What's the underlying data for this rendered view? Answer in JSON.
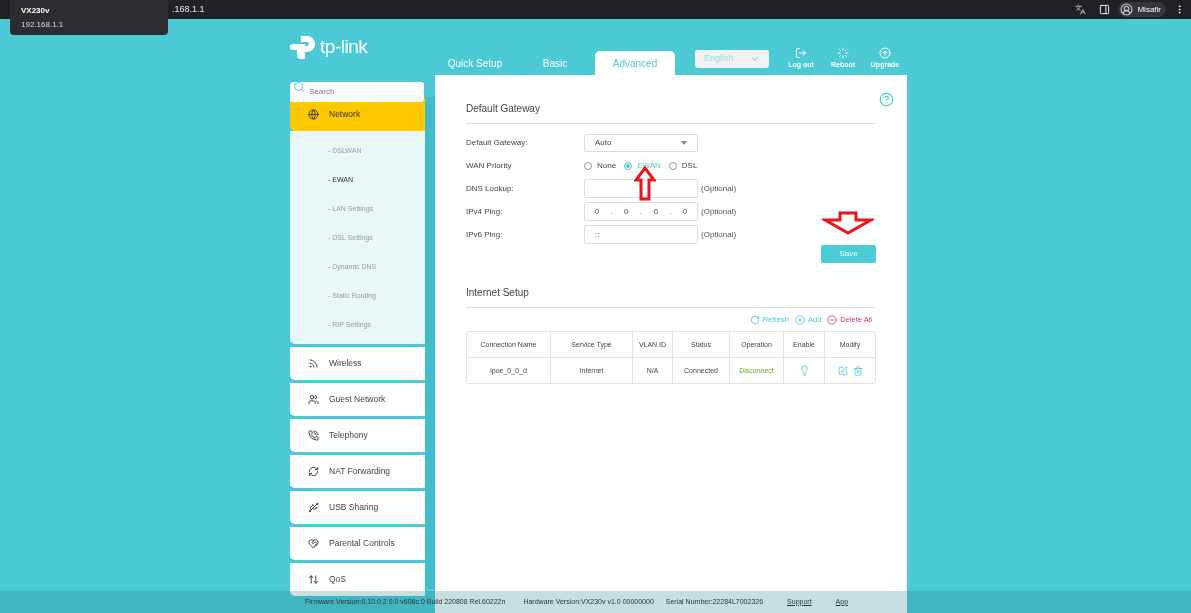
{
  "browser": {
    "address": ".168.1.1",
    "tooltip_title": "VX230v",
    "tooltip_url": "192.168.1.1",
    "profile": "Misafir"
  },
  "header": {
    "logo": "tp-link",
    "tabs": [
      {
        "label": "Quick Setup",
        "selected": false
      },
      {
        "label": "Basic",
        "selected": false
      },
      {
        "label": "Advanced",
        "selected": true
      }
    ],
    "language": "English",
    "actions": [
      {
        "kind": "logout",
        "label": "Log out"
      },
      {
        "kind": "reboot",
        "label": "Reboot"
      },
      {
        "kind": "upgrade",
        "label": "Upgrade"
      }
    ]
  },
  "search": {
    "placeholder": "Search"
  },
  "sidebar": {
    "items": [
      {
        "kind": "globe",
        "label": "Network",
        "selected": true,
        "expanded": true,
        "children": [
          {
            "label": "- DSLWAN",
            "selected": false
          },
          {
            "label": "- EWAN",
            "selected": true
          },
          {
            "label": "- LAN Settings",
            "selected": false
          },
          {
            "label": "- DSL Settings",
            "selected": false
          },
          {
            "label": "- Dynamic DNS",
            "selected": false
          },
          {
            "label": "- Static Routing",
            "selected": false
          },
          {
            "label": "- RIP Settings",
            "selected": false
          }
        ]
      },
      {
        "kind": "wireless",
        "label": "Wireless",
        "selected": false
      },
      {
        "kind": "guests",
        "label": "Guest Network",
        "selected": false
      },
      {
        "kind": "phone",
        "label": "Telephony",
        "selected": false
      },
      {
        "kind": "nat",
        "label": "NAT Forwarding",
        "selected": false
      },
      {
        "kind": "usb",
        "label": "USB Sharing",
        "selected": false
      },
      {
        "kind": "heart",
        "label": "Parental Controls",
        "selected": false
      },
      {
        "kind": "qos",
        "label": "QoS",
        "selected": false
      }
    ]
  },
  "default_gateway": {
    "title": "Default Gateway",
    "fields": [
      {
        "kind": "select",
        "label": "Default Gateway:",
        "value": "Auto"
      },
      {
        "kind": "radio",
        "label": "WAN Priority",
        "options": [
          {
            "label": "None",
            "selected": false
          },
          {
            "label": "EWAN",
            "selected": true
          },
          {
            "label": "DSL",
            "selected": false
          }
        ]
      },
      {
        "kind": "text",
        "label": "DNS Lookup:",
        "note": "(Optional)"
      },
      {
        "kind": "ip",
        "label": "IPv4 Ping:",
        "octets": [
          "0",
          "0",
          "0",
          "0"
        ],
        "separator": ".",
        "note": "(Optional)"
      },
      {
        "kind": "text",
        "label": "IPv6 Ping:",
        "value": "::",
        "note": "(Optional)"
      }
    ],
    "save": "Save"
  },
  "internet_setup": {
    "title": "Internet Setup",
    "actions": [
      {
        "kind": "refresh",
        "label": "Refresh"
      },
      {
        "kind": "add",
        "label": "Add"
      },
      {
        "kind": "delete",
        "label": "Delete All"
      }
    ],
    "columns": [
      "Connection Name",
      "Service Type",
      "VLAN ID",
      "Status",
      "Operation",
      "Enable",
      "Modify"
    ],
    "rows": [
      {
        "cells": [
          "ipoe_0_0_d",
          "Internet",
          "N/A",
          "Connected"
        ],
        "operation": "Disconnect",
        "enabled": true
      }
    ]
  },
  "footer": {
    "texts": [
      "Firmware Version:0.10.0 2.0.0 v606c.0 Build 220808 Rel.60222n",
      "Hardware Version:VX230v v1.0 00000000",
      "Serial Number:22284L7002326"
    ],
    "links": [
      "Support",
      "App"
    ]
  }
}
